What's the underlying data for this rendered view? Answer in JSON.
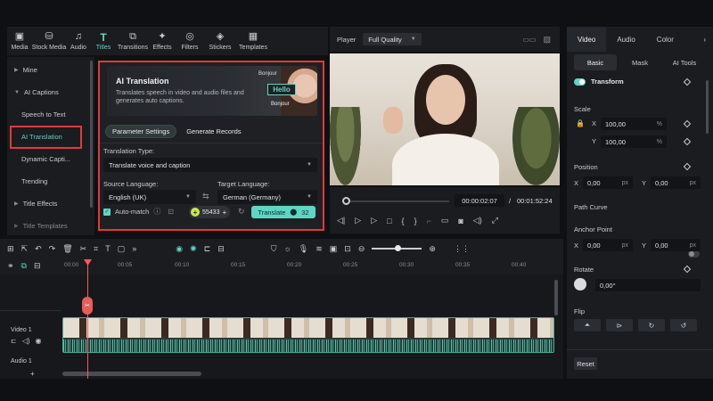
{
  "toolbar": {
    "items": [
      {
        "label": "Media",
        "icon": "media-icon"
      },
      {
        "label": "Stock Media",
        "icon": "stock-media-icon"
      },
      {
        "label": "Audio",
        "icon": "audio-icon"
      },
      {
        "label": "Titles",
        "icon": "titles-icon"
      },
      {
        "label": "Transitions",
        "icon": "transitions-icon"
      },
      {
        "label": "Effects",
        "icon": "effects-icon"
      },
      {
        "label": "Filters",
        "icon": "filters-icon"
      },
      {
        "label": "Stickers",
        "icon": "stickers-icon"
      },
      {
        "label": "Templates",
        "icon": "templates-icon"
      }
    ]
  },
  "sidebar": {
    "items": [
      {
        "label": "Mine"
      },
      {
        "label": "AI Captions"
      },
      {
        "label": "Speech to Text"
      },
      {
        "label": "AI Translation"
      },
      {
        "label": "Dynamic Capti..."
      },
      {
        "label": "Trending"
      },
      {
        "label": "Title Effects"
      },
      {
        "label": "Title Templates"
      }
    ]
  },
  "ai_panel": {
    "title": "AI Translation",
    "description": "Translates speech in video and audio files and generates auto captions.",
    "banner_words": [
      "Bonjour",
      "Hello",
      "Bonjour"
    ],
    "tabs": [
      "Parameter Settings",
      "Generate Records"
    ],
    "translation_type_label": "Translation Type:",
    "translation_type_value": "Translate voice and caption",
    "source_label": "Source Language:",
    "source_value": "English (UK)",
    "target_label": "Target Language:",
    "target_value": "German (Germany)",
    "automatch_label": "Auto-match",
    "credits": "55433",
    "translate_label": "Translate",
    "translate_cost": "32"
  },
  "player": {
    "label": "Player",
    "quality": "Full Quality",
    "current_time": "00:00:02:07",
    "separator": "/",
    "total_time": "00:01:52:24",
    "progress": 0.02
  },
  "right_panel": {
    "tabs": [
      "Video",
      "Audio",
      "Color"
    ],
    "subtabs": [
      "Basic",
      "Mask",
      "AI Tools"
    ],
    "transform_label": "Transform",
    "scale_label": "Scale",
    "scale_x": "100,00",
    "scale_y": "100,00",
    "scale_unit": "%",
    "position_label": "Position",
    "pos_x": "0,00",
    "pos_y": "0,00",
    "px_unit": "px",
    "path_curve_label": "Path Curve",
    "anchor_label": "Anchor Point",
    "anchor_x": "0,00",
    "anchor_y": "0,00",
    "rotate_label": "Rotate",
    "rotate_value": "0,00°",
    "flip_label": "Flip",
    "reset_label": "Reset",
    "x_label": "X",
    "y_label": "Y"
  },
  "timeline": {
    "ticks": [
      "00:00",
      "00:05",
      "00:10",
      "00:15",
      "00:20",
      "00:25",
      "00:30",
      "00:35",
      "00:40"
    ],
    "video_track": "Video 1",
    "audio_track": "Audio 1"
  }
}
